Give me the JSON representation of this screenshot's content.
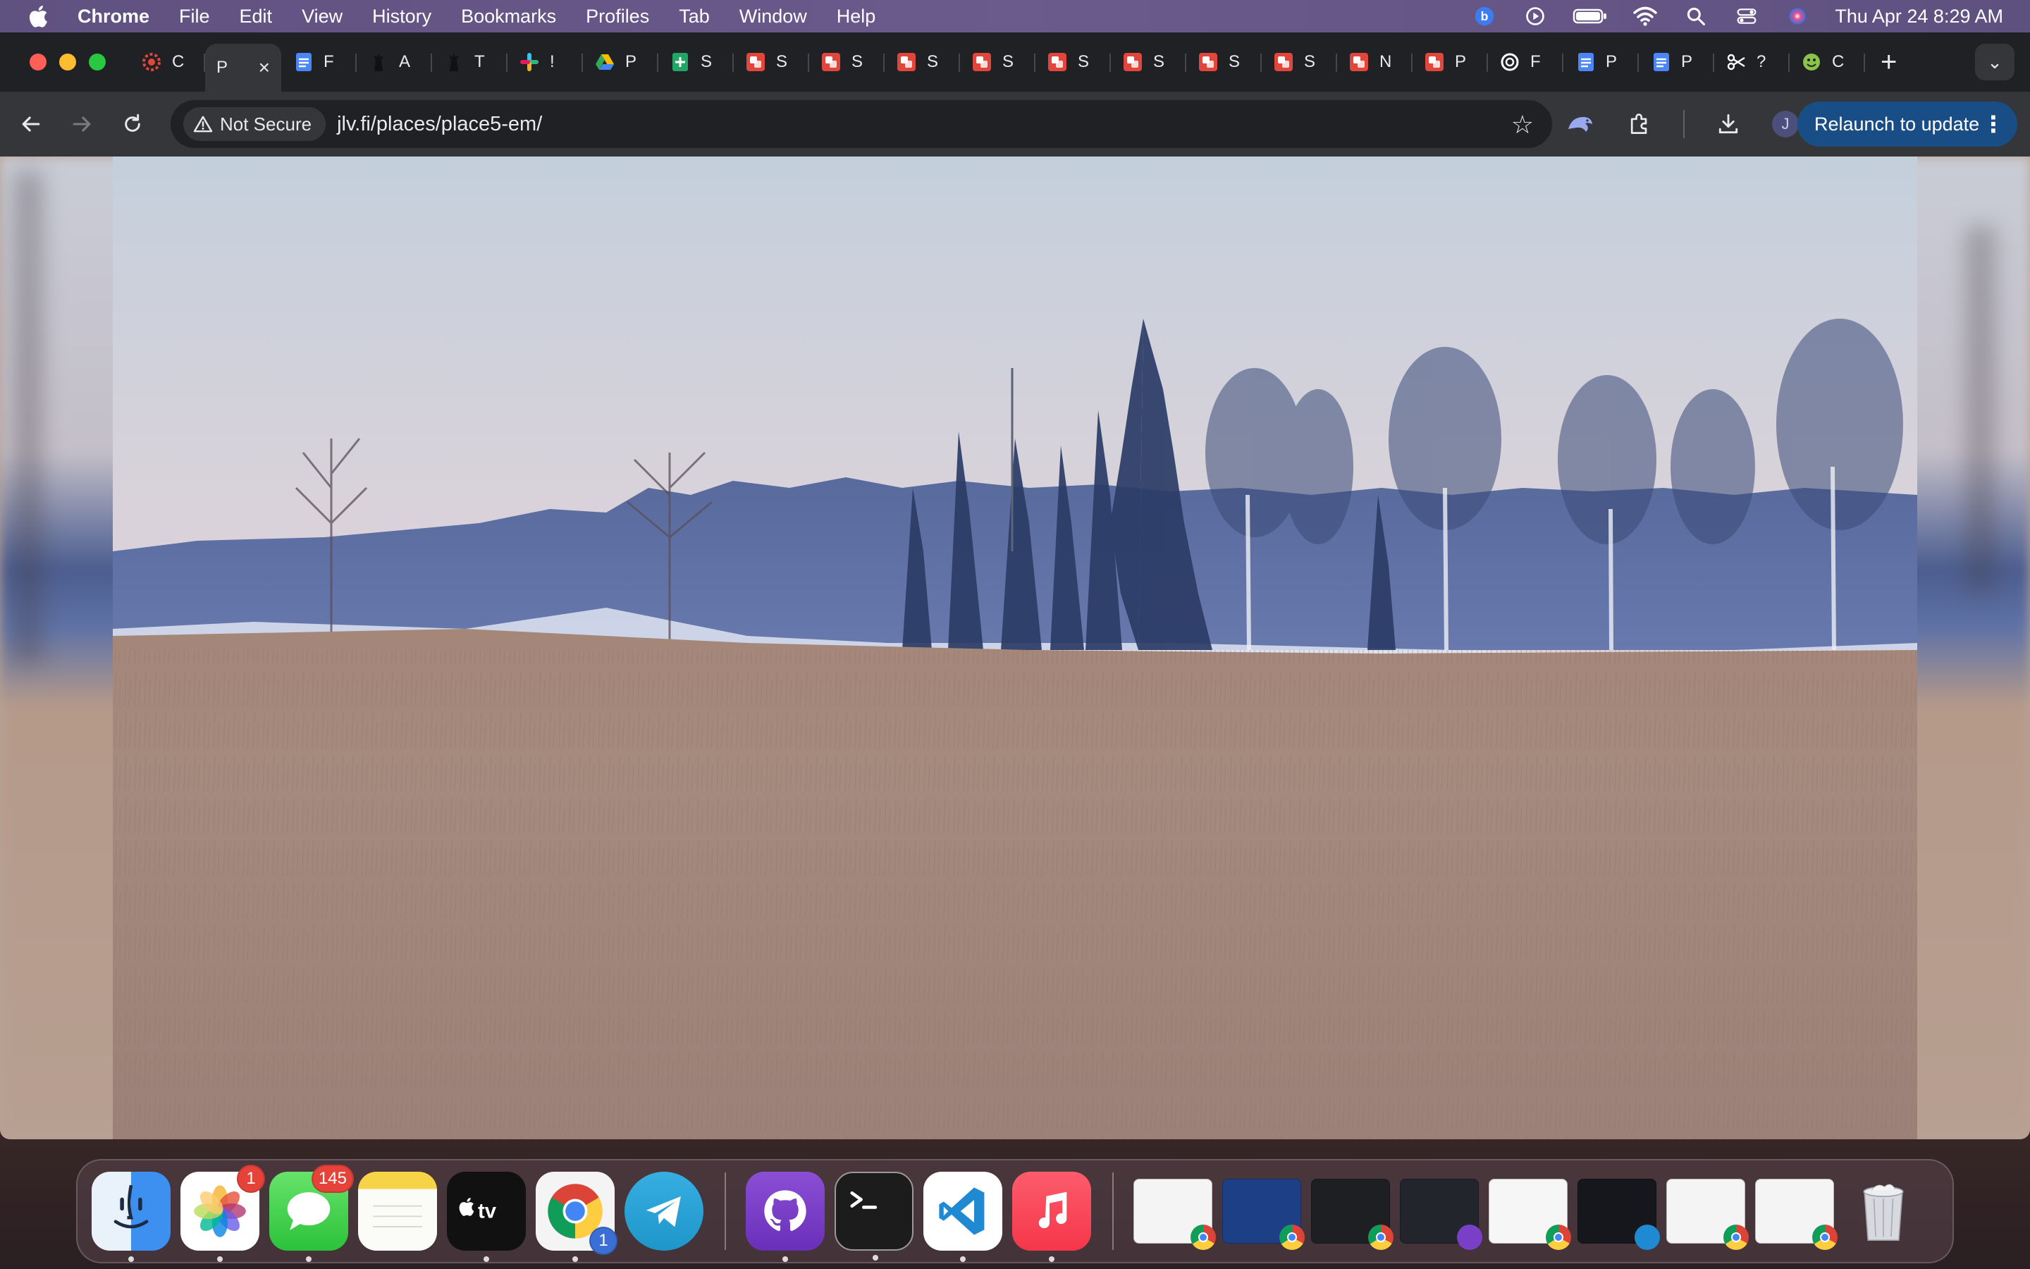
{
  "menubar": {
    "app_name": "Chrome",
    "items": [
      "File",
      "Edit",
      "View",
      "History",
      "Bookmarks",
      "Profiles",
      "Tab",
      "Window",
      "Help"
    ],
    "clock": "Thu Apr 24  8:29 AM"
  },
  "tabs": [
    {
      "label": "C",
      "favicon": "red-gear-icon",
      "color": "#e0463b"
    },
    {
      "label": "P",
      "favicon": "none",
      "active": true
    },
    {
      "label": "F",
      "favicon": "docs-icon",
      "color": "#4a86f5"
    },
    {
      "label": "A",
      "favicon": "figure-icon",
      "color": "#222222"
    },
    {
      "label": "T",
      "favicon": "figure-icon",
      "color": "#222222"
    },
    {
      "label": "!",
      "favicon": "slack-icon",
      "color": "#e01e5a"
    },
    {
      "label": "P",
      "favicon": "drive-icon",
      "color": "#34a853"
    },
    {
      "label": "S",
      "favicon": "sheets-icon",
      "color": "#23a566"
    },
    {
      "label": "S",
      "favicon": "red-square-icon",
      "color": "#e0463b"
    },
    {
      "label": "S",
      "favicon": "red-square-icon",
      "color": "#e0463b"
    },
    {
      "label": "S",
      "favicon": "red-square-icon",
      "color": "#e0463b"
    },
    {
      "label": "S",
      "favicon": "red-square-icon",
      "color": "#e0463b"
    },
    {
      "label": "S",
      "favicon": "red-square-icon",
      "color": "#e0463b"
    },
    {
      "label": "S",
      "favicon": "red-square-icon",
      "color": "#e0463b"
    },
    {
      "label": "S",
      "favicon": "red-square-icon",
      "color": "#e0463b"
    },
    {
      "label": "S",
      "favicon": "red-square-icon",
      "color": "#e0463b"
    },
    {
      "label": "N",
      "favicon": "red-square-icon",
      "color": "#e0463b"
    },
    {
      "label": "P",
      "favicon": "red-square-icon",
      "color": "#e0463b"
    },
    {
      "label": "F",
      "favicon": "openai-icon",
      "color": "#ffffff"
    },
    {
      "label": "P",
      "favicon": "docs-icon",
      "color": "#4a86f5"
    },
    {
      "label": "P",
      "favicon": "docs-icon",
      "color": "#4a86f5"
    },
    {
      "label": "?",
      "favicon": "scissors-icon",
      "color": "#ffffff"
    },
    {
      "label": "C",
      "favicon": "smiley-icon",
      "color": "#8bc34a"
    }
  ],
  "toolbar": {
    "security_label": "Not Secure",
    "url": "jlv.fi/places/place5-em/",
    "profile_initial": "J",
    "relaunch_label": "Relaunch to update"
  },
  "dock": {
    "apps": [
      {
        "name": "finder",
        "color": "#3d8ff0"
      },
      {
        "name": "photos",
        "badge": "1",
        "color": "#ffffff"
      },
      {
        "name": "messages",
        "badge": "145",
        "color": "#34c759"
      },
      {
        "name": "notes",
        "color": "#f5d04a"
      },
      {
        "name": "apple-tv",
        "color": "#111111"
      },
      {
        "name": "chrome",
        "badge": "1",
        "color": "#ffffff"
      },
      {
        "name": "telegram",
        "color": "#2aa3df"
      },
      {
        "name": "github-desktop",
        "color": "#7a3fc7"
      },
      {
        "name": "terminal",
        "color": "#1c1c1c"
      },
      {
        "name": "vscode",
        "color": "#ffffff"
      },
      {
        "name": "music",
        "color": "#fa3c4c"
      }
    ],
    "windows": 8
  },
  "colors": {
    "menubar": "#6b5a8c",
    "tab_strip": "#202124",
    "toolbar": "#35363a",
    "relaunch": "#194d86"
  }
}
